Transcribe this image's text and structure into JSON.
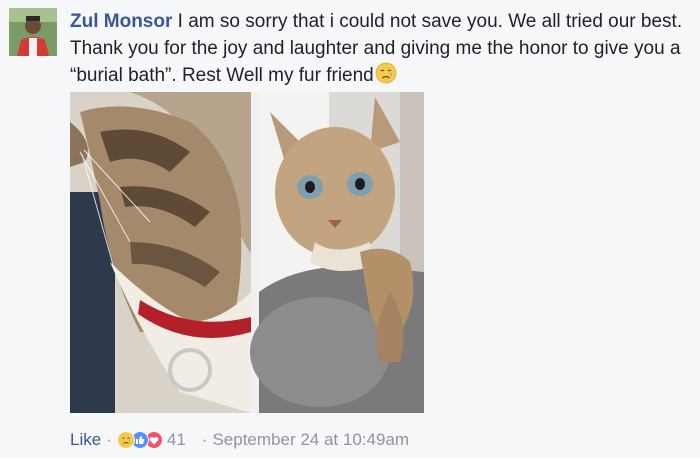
{
  "comment": {
    "author": "Zul Monsor",
    "text": " I am so sorry that i could not save you. We all tried our best. Thank you for the joy and laughter and giving me the honor to give you a “burial bath”. Rest Well my fur friend",
    "emoji_icon": "crying-face-icon"
  },
  "photo": {
    "left_image": "cat-side-profile-red-collar",
    "right_image": "cat-wide-eyes-grey-pillow"
  },
  "footer": {
    "like_label": "Like",
    "separator": "·",
    "reactions": [
      "sad-reaction-icon",
      "like-reaction-icon",
      "love-reaction-icon"
    ],
    "reaction_count": "41",
    "timestamp": "September 24 at 10:49am"
  },
  "colors": {
    "author_link": "#365899",
    "meta_text": "#90949c",
    "background": "#f6f7f9"
  }
}
